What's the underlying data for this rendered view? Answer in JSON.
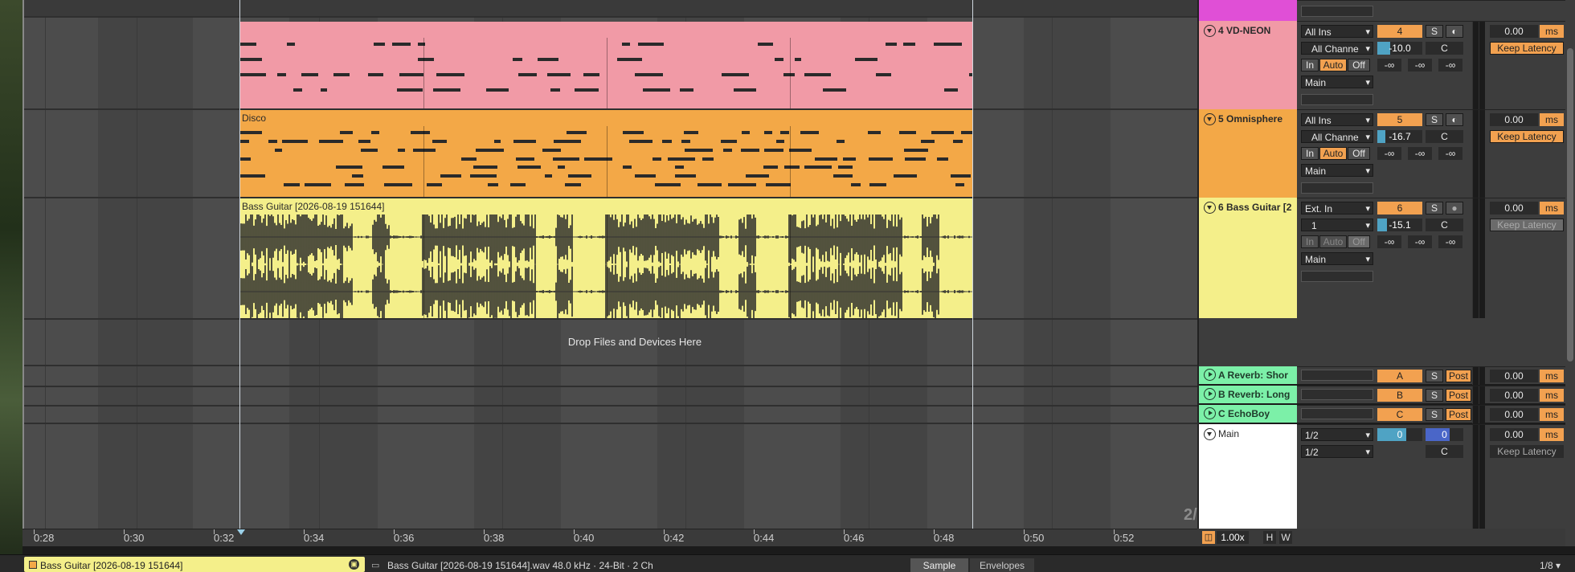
{
  "ruler": {
    "labels": [
      "0:28",
      "0:30",
      "0:32",
      "0:34",
      "0:36",
      "0:38",
      "0:40",
      "0:42",
      "0:44",
      "0:46",
      "0:48",
      "0:50",
      "0:52"
    ]
  },
  "clips": {
    "vdneon": {
      "title": "",
      "color": "#f19aa6"
    },
    "disco": {
      "title": "Disco",
      "color": "#f3a847"
    },
    "bass": {
      "title": "Bass Guitar [2026-08-19 151644]",
      "color": "#f4ef8a"
    }
  },
  "drop_zone": "Drop Files and Devices Here",
  "page_indicator": "2/1",
  "tracks": [
    {
      "name": "4 VD-NEON",
      "color": "#f19aa6",
      "input_type": "All Ins",
      "input_channel": "All Channe",
      "monitor": [
        "In",
        "Auto",
        "Off"
      ],
      "monitor_active": "Auto",
      "output": "Main",
      "number": "4",
      "solo": "S",
      "volume": "-10.0",
      "pan": "C",
      "inf": [
        "-∞",
        "-∞",
        "-∞"
      ],
      "delay": "0.00",
      "delay_unit": "ms",
      "latency": "Keep Latency"
    },
    {
      "name": "5 Omnisphere",
      "color": "#f3a847",
      "input_type": "All Ins",
      "input_channel": "All Channe",
      "monitor": [
        "In",
        "Auto",
        "Off"
      ],
      "monitor_active": "Auto",
      "output": "Main",
      "number": "5",
      "solo": "S",
      "volume": "-16.7",
      "pan": "C",
      "inf": [
        "-∞",
        "-∞",
        "-∞"
      ],
      "delay": "0.00",
      "delay_unit": "ms",
      "latency": "Keep Latency"
    },
    {
      "name": "6 Bass Guitar [2",
      "color": "#f4ef8a",
      "input_type": "Ext. In",
      "input_channel": "1",
      "monitor": [
        "In",
        "Auto",
        "Off"
      ],
      "monitor_active": "Off",
      "output": "Main",
      "number": "6",
      "solo": "S",
      "volume": "-15.1",
      "pan": "C",
      "inf": [
        "-∞",
        "-∞",
        "-∞"
      ],
      "delay": "0.00",
      "delay_unit": "ms",
      "latency": "Keep Latency"
    }
  ],
  "returns": [
    {
      "name": "A Reverb: Shor",
      "letter": "A",
      "solo": "S",
      "post": "Post",
      "delay": "0.00",
      "delay_unit": "ms"
    },
    {
      "name": "B Reverb: Long",
      "letter": "B",
      "solo": "S",
      "post": "Post",
      "delay": "0.00",
      "delay_unit": "ms"
    },
    {
      "name": "C EchoBoy",
      "letter": "C",
      "solo": "S",
      "post": "Post",
      "delay": "0.00",
      "delay_unit": "ms"
    }
  ],
  "main": {
    "name": "Main",
    "output1": "1/2",
    "output2": "1/2",
    "value_a": "0",
    "value_b": "0",
    "pan": "C",
    "delay": "0.00",
    "delay_unit": "ms",
    "latency": "Keep Latency"
  },
  "zoom": {
    "value": "1.00x",
    "h": "H",
    "w": "W"
  },
  "bottom": {
    "clip_name": "Bass Guitar [2026-08-19 151644]",
    "file_info": "Bass Guitar [2026-08-19 151644].wav  48.0 kHz · 24-Bit · 2 Ch",
    "tab_sample": "Sample",
    "tab_envelopes": "Envelopes",
    "quantization": "1/8 ▾"
  },
  "colors": {
    "magenta_track": "#e04fd6",
    "return_green": "#7cf0a8",
    "accent_orange": "#f2a150",
    "volume_blue": "#4fa3c4"
  }
}
